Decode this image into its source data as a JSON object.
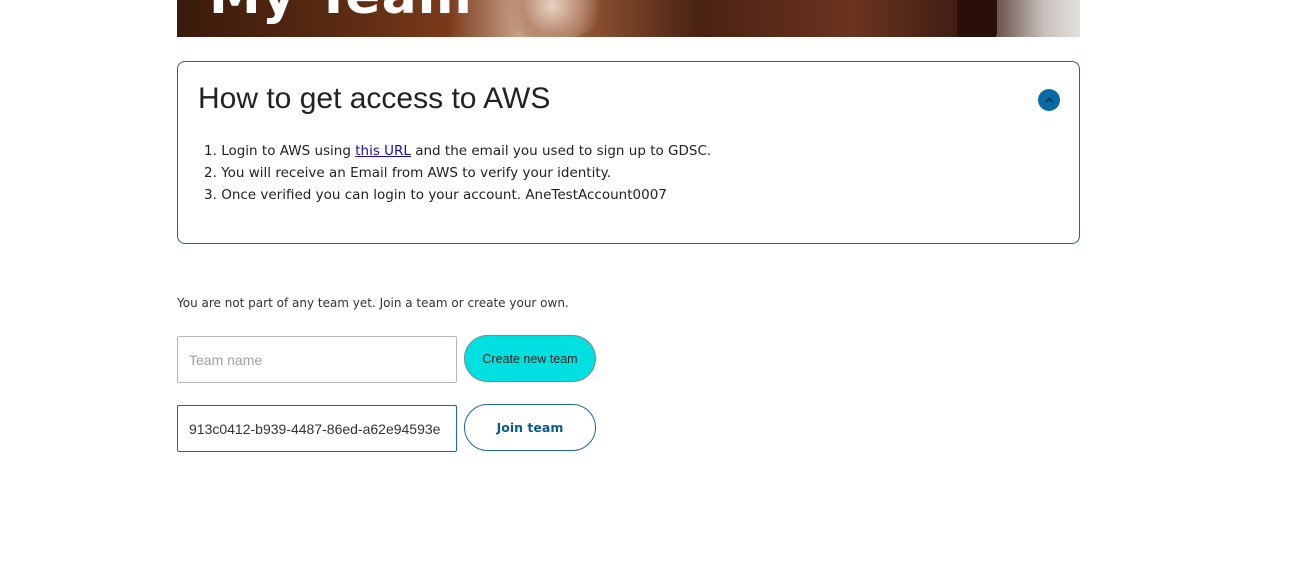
{
  "hero": {
    "title": "My Team"
  },
  "access_card": {
    "title": "How to get access to AWS",
    "toggle_icon": "chevron-up-icon",
    "steps": [
      {
        "number": "1.",
        "before_link": "Login to AWS using ",
        "link_text": "this URL",
        "after_link": " and the email you used to sign up to GDSC."
      },
      {
        "number": "2.",
        "text": "You will receive an Email from AWS to verify your identity."
      },
      {
        "number": "3.",
        "text": "Once verified you can login to your account. AneTestAccount0007"
      }
    ]
  },
  "team": {
    "status_text": "You are not part of any team yet. Join a team or create your own.",
    "team_name_placeholder": "Team name",
    "team_name_value": "",
    "create_button_label": "Create new team",
    "join_id_value": "913c0412-b939-4487-86ed-a62e94593e",
    "join_button_label": "Join team"
  },
  "colors": {
    "accent": "#1c6a98",
    "toggle": "#0a6aa8",
    "create_button": "#00e0e0",
    "link": "#1a0dab"
  }
}
